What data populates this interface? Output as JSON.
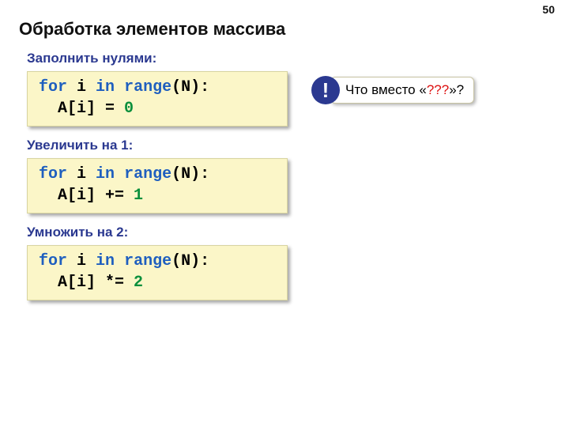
{
  "page_number": "50",
  "title": "Обработка элементов массива",
  "sections": [
    {
      "heading": "Заполнить нулями:"
    },
    {
      "heading": "Увеличить на 1:"
    },
    {
      "heading": "Умножить на 2:"
    }
  ],
  "code": {
    "fill_zero": {
      "kw_for": "for",
      "kw_in": "in",
      "kw_range": "range",
      "var": " i ",
      "call": "(N):",
      "body": "  A[i] = ",
      "val": "0"
    },
    "inc_one": {
      "kw_for": "for",
      "kw_in": "in",
      "kw_range": "range",
      "var": " i ",
      "call": "(N):",
      "body": "  A[i] += ",
      "val": "1"
    },
    "mul_two": {
      "kw_for": "for",
      "kw_in": "in",
      "kw_range": "range",
      "var": " i ",
      "call": "(N):",
      "body": "  A[i] *= ",
      "val": "2"
    }
  },
  "callout": {
    "bang": "!",
    "pre": "Что вместо «",
    "q": "???",
    "post": "»?"
  }
}
